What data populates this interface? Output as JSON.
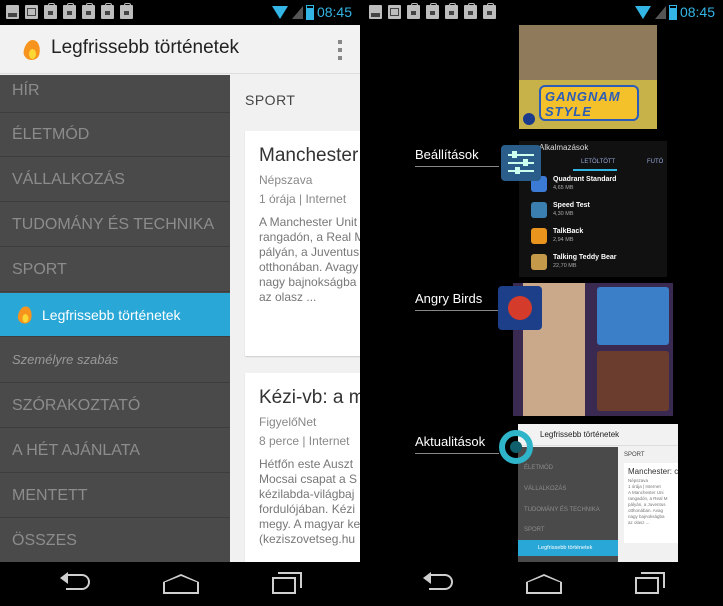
{
  "status_bar": {
    "time": "08:45"
  },
  "left_screen": {
    "action_bar": {
      "title": "Legfrissebb történetek"
    },
    "drawer": {
      "items": [
        {
          "label": "HÍR"
        },
        {
          "label": "ÉLETMÓD"
        },
        {
          "label": "VÁLLALKOZÁS"
        },
        {
          "label": "TUDOMÁNY ÉS TECHNIKA"
        },
        {
          "label": "SPORT"
        },
        {
          "label": "Legfrissebb történetek"
        },
        {
          "label": "Személyre szabás"
        },
        {
          "label": "SZÓRAKOZTATÓ"
        },
        {
          "label": "A HÉT AJÁNLATA"
        },
        {
          "label": "MENTETT"
        },
        {
          "label": "ÖSSZES"
        }
      ]
    },
    "content": {
      "section_label": "SPORT",
      "articles": [
        {
          "title": "Manchester: c",
          "source": "Népszava",
          "meta": "1 órája | Internet",
          "body": "A Manchester Unit\nrangadón, a Real M\npályán, a Juventus\notthonában. Avagy\nnagy bajnokságba\naz olasz ..."
        },
        {
          "title": "Kézi-vb: a mag",
          "source": "FigyelőNet",
          "meta": "8 perce | Internet",
          "body": "Hétfőn este Auszt\nMocsai csapat a S\nkézilabda-világbaj\nfordulójában. Kézi\nmegy. A magyar ke\n(keziszovetseg.hu"
        }
      ]
    }
  },
  "right_screen": {
    "recent_apps": [
      {
        "label": "Beállítások"
      },
      {
        "label": "Angry Birds"
      },
      {
        "label": "Aktualitások"
      }
    ],
    "settings_thumb": {
      "title": "Alkalmazások",
      "tab_active": "LETÖLTÖTT",
      "tab_other": "FUTÓ",
      "apps": [
        {
          "name": "Quadrant Standard",
          "size": "4,65 MB",
          "color": "#3b7bd6"
        },
        {
          "name": "Speed Test",
          "size": "4,30 MB",
          "color": "#3a7fb0"
        },
        {
          "name": "TalkBack",
          "size": "2,94 MB",
          "color": "#e8941d"
        },
        {
          "name": "Talking Teddy Bear",
          "size": "22,70 MB",
          "color": "#c49a4a"
        }
      ]
    },
    "game_thumb": {
      "banner": "GANGNAM STYLE"
    },
    "news_thumb": {
      "title": "Legfrissebb történetek",
      "drawer_items": [
        "ÉLETMÓD",
        "VÁLLALKOZÁS",
        "TUDOMÁNY ÉS TECHNIKA",
        "SPORT"
      ],
      "active_item": "Legfrissebb történetek",
      "section_label": "SPORT",
      "card_title": "Manchester: c",
      "card_body": "Népszava\n1 órája | Internet\nA Manchester Uni\nrangadón, a Real M\npályán, a Juventus\notthonában. Avag\nnagy bajnokságba\naz olasz ..."
    }
  },
  "colors": {
    "accent": "#33b5e5",
    "drawer_bg": "#4a4a4a",
    "drawer_active": "#29a8d8"
  }
}
